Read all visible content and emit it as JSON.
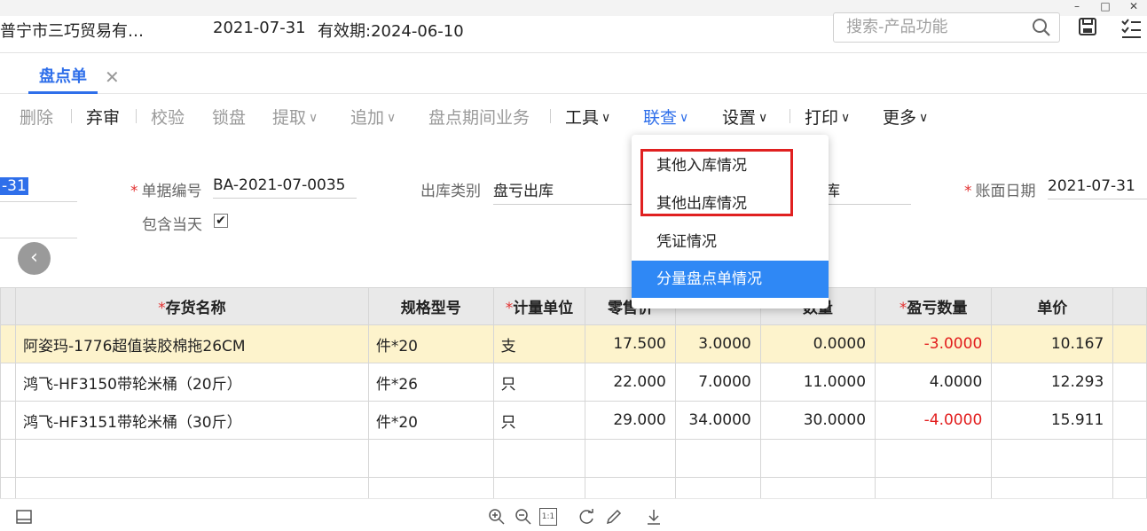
{
  "header": {
    "company": "普宁市三巧贸易有…",
    "date": "2021-07-31",
    "valid_label": "有效期:",
    "valid_date": "2024-06-10",
    "search_placeholder": "搜索-产品功能"
  },
  "tabs": [
    {
      "label": "盘点单",
      "active": true
    }
  ],
  "toolbar": {
    "delete": "删除",
    "abandon": "弃审",
    "verify": "校验",
    "lock": "锁盘",
    "fetch": "提取",
    "append": "追加",
    "period": "盘点期间业务",
    "tools": "工具",
    "link": "联查",
    "settings": "设置",
    "print": "打印",
    "more": "更多"
  },
  "form": {
    "date_fragment": "-31",
    "doc_no_label": "单据编号",
    "doc_no": "BA-2021-07-0035",
    "out_type_label": "出库类别",
    "out_type": "盘亏出库",
    "in_type_fragment": "库",
    "book_date_label": "账面日期",
    "book_date": "2021-07-31",
    "include_today_label": "包含当天",
    "include_today_checked": true
  },
  "table": {
    "columns": [
      "存货名称",
      "规格型号",
      "计量单位",
      "零售价",
      "",
      "数量",
      "盈亏数量",
      "单价",
      ""
    ],
    "required": [
      true,
      false,
      true,
      false,
      false,
      false,
      true,
      false,
      false
    ],
    "rows": [
      {
        "name": "阿姿玛-1776超值装胶棉拖26CM",
        "spec": "件*20",
        "unit": "支",
        "price": "17.500",
        "c5": "3.0000",
        "qty": "0.0000",
        "diff": "-3.0000",
        "unit_price": "10.167",
        "neg": true
      },
      {
        "name": "鸿飞-HF3150带轮米桶（20斤）",
        "spec": "件*26",
        "unit": "只",
        "price": "22.000",
        "c5": "7.0000",
        "qty": "11.0000",
        "diff": "4.0000",
        "unit_price": "12.293",
        "neg": false
      },
      {
        "name": "鸿飞-HF3151带轮米桶（30斤）",
        "spec": "件*20",
        "unit": "只",
        "price": "29.000",
        "c5": "34.0000",
        "qty": "30.0000",
        "diff": "-4.0000",
        "unit_price": "15.911",
        "neg": true
      }
    ]
  },
  "dropdown": {
    "items": [
      {
        "label": "其他入库情况",
        "selected": false
      },
      {
        "label": "其他出库情况",
        "selected": false
      },
      {
        "label": "凭证情况",
        "selected": false
      },
      {
        "label": "分量盘点单情况",
        "selected": true
      }
    ]
  },
  "colors": {
    "accent": "#2f6fea",
    "highlight_row": "#fdf3cc",
    "negative": "#e21d1d",
    "menu_selected": "#2f88f5",
    "annotation_box": "#e02020"
  },
  "icons": [
    "search-icon",
    "save-icon",
    "list-icon",
    "close-icon",
    "back-arrow-icon",
    "checkbox-icon",
    "sidebar-icon",
    "zoom-in-icon",
    "zoom-out-icon",
    "actual-size-icon",
    "refresh-icon",
    "edit-icon",
    "download-icon"
  ],
  "bottombar": {
    "actual_size": "1:1"
  }
}
